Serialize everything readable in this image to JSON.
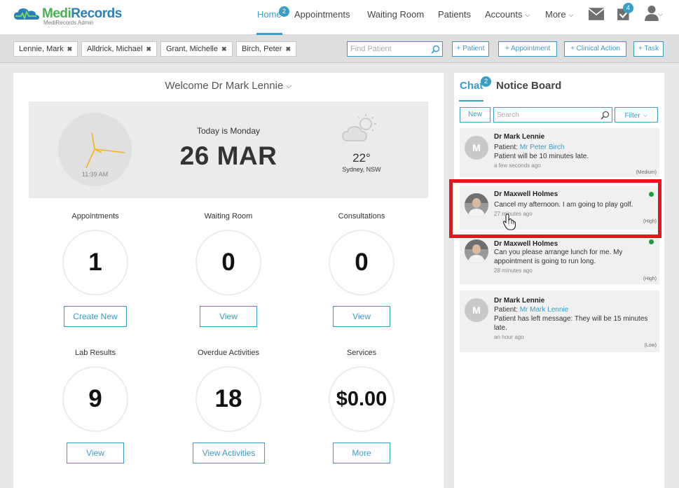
{
  "app": {
    "name_part1": "Medi",
    "name_part2": "Records",
    "subtitle": "MediRecords Admin"
  },
  "nav": {
    "items": [
      {
        "label": "Home",
        "active": true,
        "badge": "2"
      },
      {
        "label": "Appointments"
      },
      {
        "label": "Waiting Room"
      },
      {
        "label": "Patients"
      },
      {
        "label": "Accounts",
        "dropdown": true
      },
      {
        "label": "More",
        "dropdown": true
      }
    ],
    "icons": [
      {
        "name": "mail-icon"
      },
      {
        "name": "tasks-icon",
        "badge": "4"
      },
      {
        "name": "user-icon",
        "dropdown": true
      }
    ]
  },
  "patient_tabs": [
    {
      "label": "Lennie, Mark"
    },
    {
      "label": "Alldrick, Michael"
    },
    {
      "label": "Grant, Michelle"
    },
    {
      "label": "Birch, Peter"
    }
  ],
  "find_patient": {
    "placeholder": "Find Patient"
  },
  "actions": [
    "+ Patient",
    "+ Appointment",
    "+ Clinical Action",
    "+ Task"
  ],
  "dashboard": {
    "welcome": "Welcome Dr Mark Lennie",
    "clock_time": "11:39 AM",
    "today_label": "Today is Monday",
    "date": "26 MAR",
    "temperature": "22°",
    "location": "Sydney, NSW",
    "stats": [
      {
        "label": "Appointments",
        "value": "1",
        "button": "Create New"
      },
      {
        "label": "Waiting Room",
        "value": "0",
        "button": "View"
      },
      {
        "label": "Consultations",
        "value": "0",
        "button": "View"
      },
      {
        "label": "Lab Results",
        "value": "9",
        "button": "View"
      },
      {
        "label": "Overdue Activities",
        "value": "18",
        "button": "View Activities"
      },
      {
        "label": "Services",
        "value": "$0.00",
        "button": "More"
      }
    ]
  },
  "chat": {
    "tab_chat": "Chat",
    "tab_chat_badge": "2",
    "tab_notice": "Notice Board",
    "new_label": "New",
    "search_placeholder": "Search",
    "filter_label": "Filter",
    "messages": [
      {
        "author": "Dr Mark Lennie",
        "avatar_letter": "M",
        "patient_prefix": "Patient:",
        "patient": "Mr Peter Birch",
        "text": "Patient will be 10 minutes late.",
        "time": "a few seconds ago",
        "priority": "(Medium)"
      },
      {
        "author": "Dr Maxwell Holmes",
        "text": "Cancel my afternoon. I am going to play golf.",
        "time": "27 minutes ago",
        "priority": "(High)",
        "online": true
      },
      {
        "author": "Dr Maxwell Holmes",
        "text_line1": "Can you please arrange lunch for me. My",
        "text_line2": "appointment is going to run long.",
        "time": "28 minutes ago",
        "priority": "(High)",
        "online": true
      },
      {
        "author": "Dr Mark Lennie",
        "avatar_letter": "M",
        "patient_prefix": "Patient:",
        "patient": "Mr Mark Lennie",
        "text_line1": "Patient has left message: They will be 15 minutes",
        "text_line2": "late.",
        "time": "an hour ago",
        "priority": "(Low)"
      }
    ]
  },
  "colors": {
    "accent": "#3a9dc6",
    "brand_green": "#4caf50",
    "brand_blue": "#2a7fb8",
    "highlight": "#e8141c",
    "online": "#1a9a3a"
  }
}
